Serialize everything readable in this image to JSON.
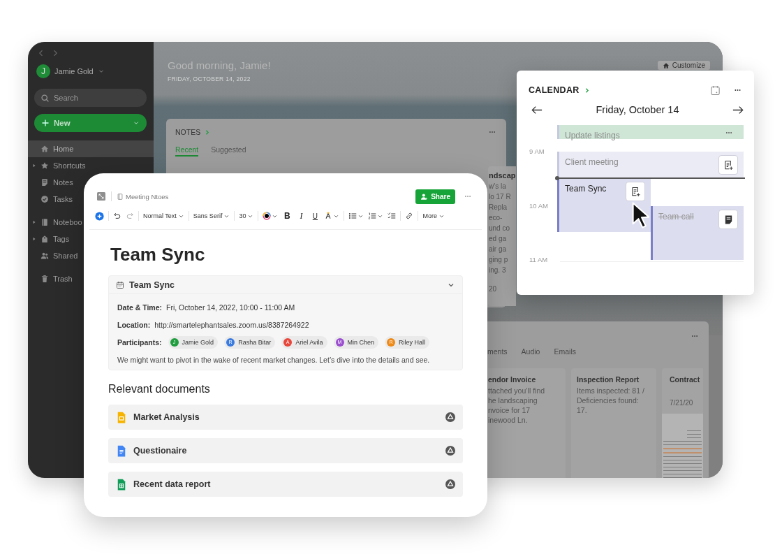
{
  "app": {
    "sidebar": {
      "user": {
        "initial": "J",
        "name": "Jamie Gold"
      },
      "search": {
        "placeholder": "Search"
      },
      "new_button": "New",
      "items": [
        {
          "label": "Home",
          "selected": true
        },
        {
          "label": "Shortcuts",
          "selected": false,
          "expanded": false
        },
        {
          "label": "Notes",
          "selected": false
        },
        {
          "label": "Tasks",
          "selected": false
        },
        {
          "label": "Noteboo",
          "selected": false,
          "expanded": false
        },
        {
          "label": "Tags",
          "selected": false,
          "expanded": false
        },
        {
          "label": "Shared",
          "selected": false
        },
        {
          "label": "Trash",
          "selected": false
        }
      ]
    },
    "greeting": "Good morning, Jamie!",
    "date": "FRIDAY, OCTOBER 14, 2022",
    "customize_button": "Customize",
    "notes_widget": {
      "title": "NOTES",
      "tabs": [
        {
          "label": "Recent",
          "selected": true
        },
        {
          "label": "Suggested",
          "selected": false
        }
      ],
      "note": {
        "title": "ndscap",
        "snippet": "w's la\nlo 17 R\nRepla\neco-\nund co\ned ga\nair ga\nging p\ning. 3",
        "date": "20"
      }
    },
    "files_widget": {
      "tabs": [
        {
          "label": "ments",
          "selected": false
        },
        {
          "label": "Audio",
          "selected": false
        },
        {
          "label": "Emails",
          "selected": false
        }
      ],
      "cards": [
        {
          "kind": "text",
          "title": "endor Invoice",
          "snippet": "ttached you’ll find\nhe landscaping\nnvoice for 17\ninewood Ln."
        },
        {
          "kind": "text",
          "title": "Inspection Report",
          "snippet": "Items inspected: 81 /\nDeficiencies found:\n17."
        },
        {
          "kind": "document",
          "title": "Contract",
          "date": "7/21/20"
        }
      ]
    }
  },
  "editor": {
    "notebook": "Meeting Ntoes",
    "share_button": "Share",
    "toolbar": {
      "dropdowns": [
        "Normal Text",
        "Sans Serif",
        "30"
      ],
      "format": [
        "B",
        "I",
        "U"
      ],
      "more": "More"
    },
    "title": "Team Sync",
    "event": {
      "title": "Team Sync",
      "expanded": true,
      "fields": [
        {
          "label": "Date & Time:",
          "value": "Fri, October 14, 2022, 10:00 - 11:00 AM"
        },
        {
          "label": "Location:",
          "value": "http://smartelephantsales.zoom.us/8387264922"
        }
      ],
      "participants_label": "Participants:",
      "participants": [
        {
          "initial": "J",
          "name": "Jamie Gold",
          "color": "#1f9d3f"
        },
        {
          "initial": "R",
          "name": "Rasha Bitar",
          "color": "#3b7be0"
        },
        {
          "initial": "A",
          "name": "Ariel Avila",
          "color": "#e8473c"
        },
        {
          "initial": "M",
          "name": "Min Chen",
          "color": "#9b4fd0"
        },
        {
          "initial": "R",
          "name": "Riley Hall",
          "color": "#ee8a1a"
        }
      ],
      "description": "We might want to pivot in the wake of recent market changes. Let’s dive into the details and see."
    },
    "documents_heading": "Relevant documents",
    "documents": [
      {
        "kind": "slides",
        "title": "Market Analysis"
      },
      {
        "kind": "doc",
        "title": "Questionaire"
      },
      {
        "kind": "sheet",
        "title": "Recent data report"
      }
    ]
  },
  "calendar": {
    "title": "CALENDAR",
    "day": "Friday, October 14",
    "hours": [
      "9 AM",
      "10 AM",
      "11 AM"
    ],
    "events": [
      {
        "title": "Update listings",
        "color": "#cfe6d6",
        "faded": true,
        "struck": false,
        "kind": "menu"
      },
      {
        "title": "Client meeting",
        "color": "#ebebf6",
        "faded": true,
        "struck": false,
        "kind": "add-note"
      },
      {
        "title": "Team Sync",
        "color": "#dcddee",
        "faded": false,
        "struck": false,
        "kind": "add-note"
      },
      {
        "title": "Team call",
        "color": "#dcddee",
        "faded": false,
        "struck": true,
        "kind": "note"
      }
    ]
  }
}
